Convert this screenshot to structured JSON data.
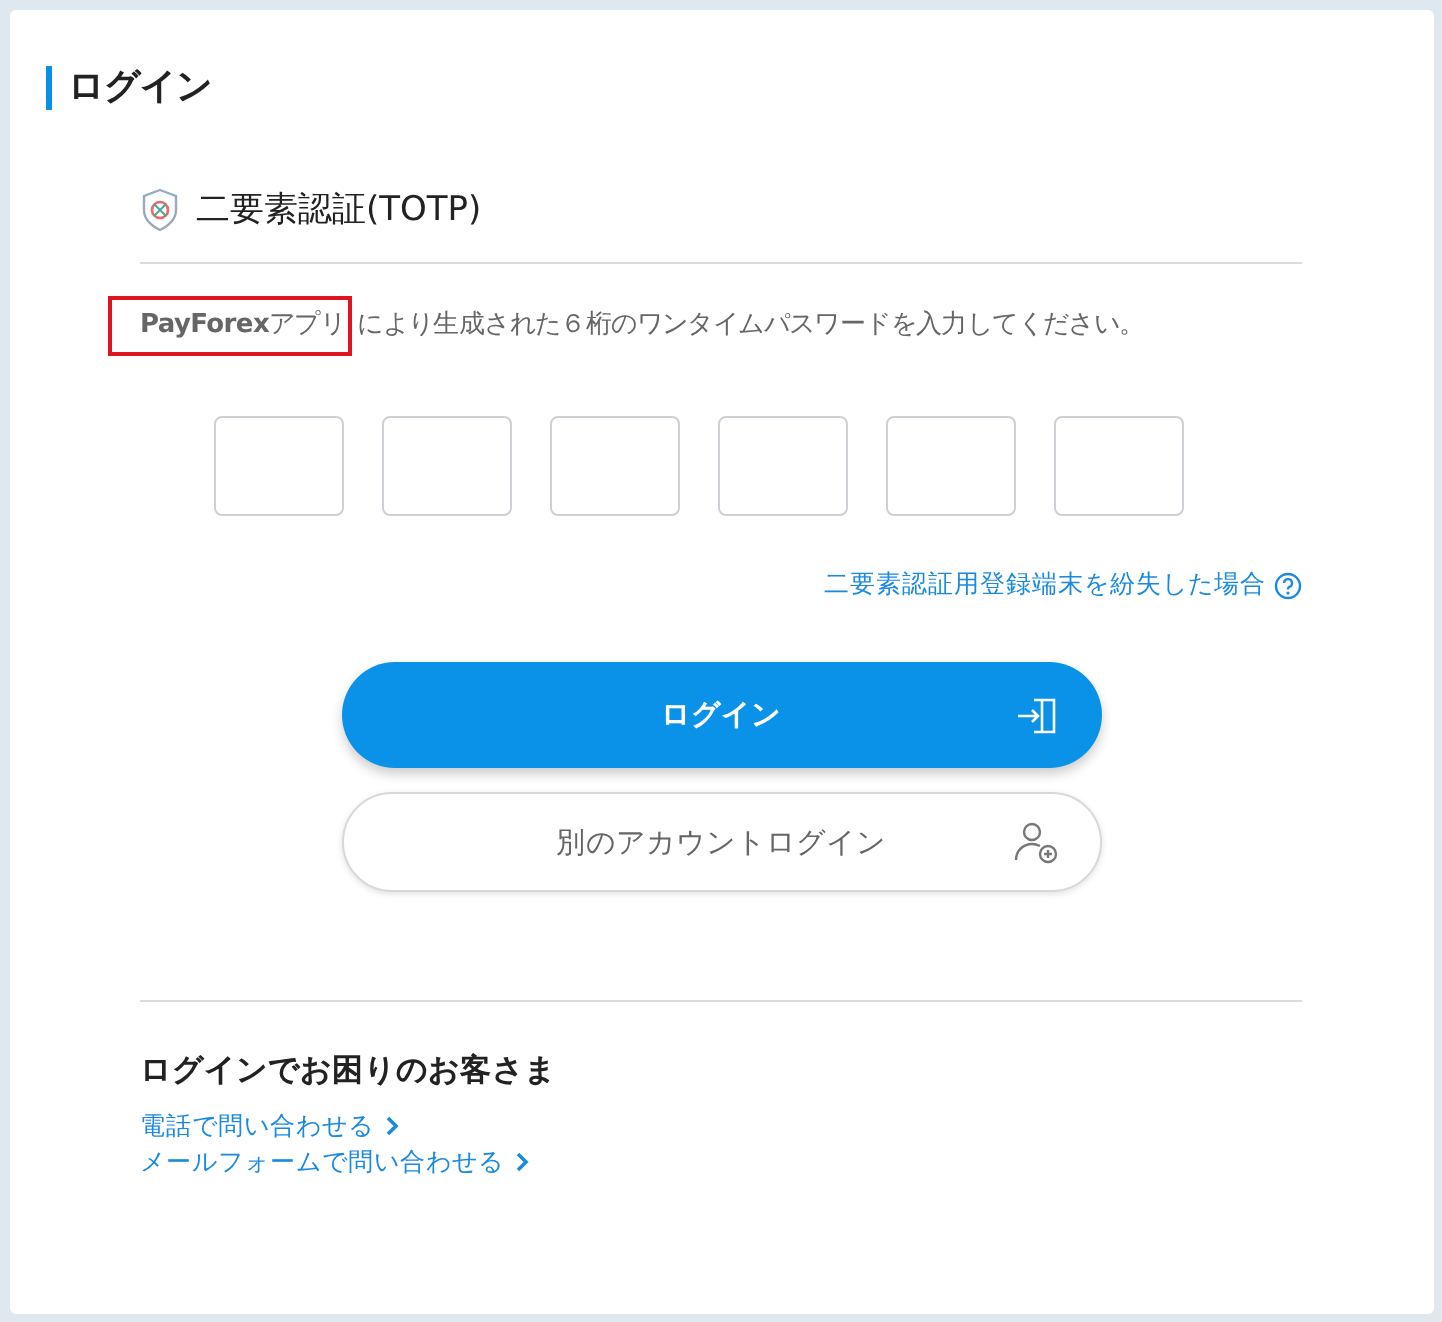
{
  "page_title": "ログイン",
  "section": {
    "title": "二要素認証(TOTP)",
    "description": "**PayForex**アプリ",
    "description_rest": "により生成された６桁のワンタイムパスワードを入力してください。"
  },
  "code_fields": [
    {
      "kind": "digit"
    },
    {
      "kind": "digit"
    },
    {
      "kind": "digit"
    },
    {
      "kind": "digit"
    },
    {
      "kind": "digit"
    },
    {
      "kind": "digit"
    }
  ],
  "lost_device_link": "二要素認証用登録端末を紛失した場合",
  "buttons": [
    {
      "kind": "primary",
      "label": "ログイン"
    },
    {
      "kind": "secondary",
      "label": "別のアカウントログイン"
    }
  ],
  "help": {
    "title": "ログインでお困りのお客さま",
    "links": [
      "電話で問い合わせる",
      "メールフォームで問い合わせる"
    ]
  }
}
